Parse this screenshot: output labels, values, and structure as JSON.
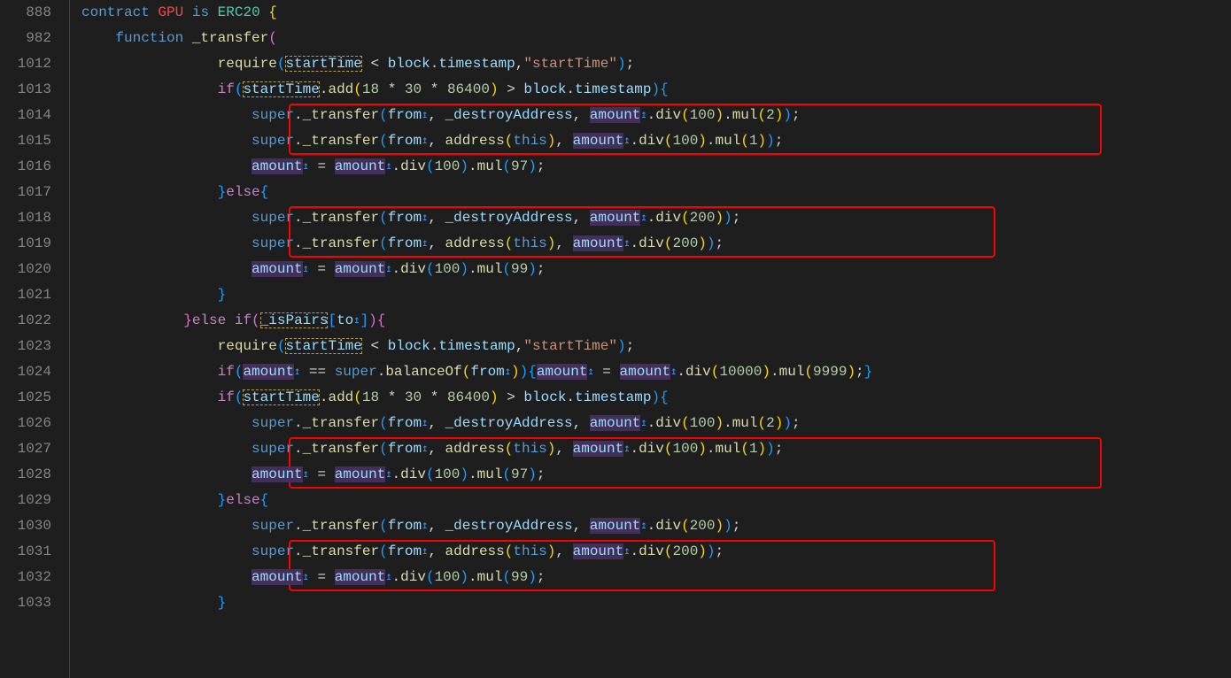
{
  "lineNumbers": [
    "888",
    "982",
    "1012",
    "1013",
    "1014",
    "1015",
    "1016",
    "1017",
    "1018",
    "1019",
    "1020",
    "1021",
    "1022",
    "1023",
    "1024",
    "1025",
    "1026",
    "1027",
    "1028",
    "1029",
    "1030",
    "1031",
    "1032",
    "1033"
  ],
  "tokens": {
    "kw_contract": "contract",
    "kw_is": "is",
    "kw_function": "function",
    "kw_super": "super",
    "kw_else": "else",
    "kw_if": "if",
    "kw_this": "this",
    "name_GPU": "GPU",
    "name_ERC20": "ERC20",
    "name__transfer": "_transfer",
    "name_require": "require",
    "name_startTime": "startTime",
    "name_block": "block",
    "name_timestamp": "timestamp",
    "name_add": "add",
    "name_from": "from",
    "name__destroyAddress": "_destroyAddress",
    "name_amount": "amount",
    "name_div": "div",
    "name_mul": "mul",
    "name_address": "address",
    "name__isPairs": "_isPairs",
    "name_to": "to",
    "name_balanceOf": "balanceOf",
    "str_startTime": "\"startTime\"",
    "num_18": "18",
    "num_30": "30",
    "num_86400": "86400",
    "num_100": "100",
    "num_2": "2",
    "num_1": "1",
    "num_97": "97",
    "num_200": "200",
    "num_99": "99",
    "num_10000": "10000",
    "num_9999": "9999",
    "op_lt": "<",
    "op_gt": ">",
    "op_star": "*",
    "op_eq": "=",
    "op_eqeq": "==",
    "punc_sc": ";",
    "punc_c": ",",
    "brace_o": "{",
    "brace_c": "}",
    "paren_o": "(",
    "paren_c": ")",
    "bracket_o": "[",
    "bracket_c": "]",
    "dot": ".",
    "arrow": "↥"
  }
}
